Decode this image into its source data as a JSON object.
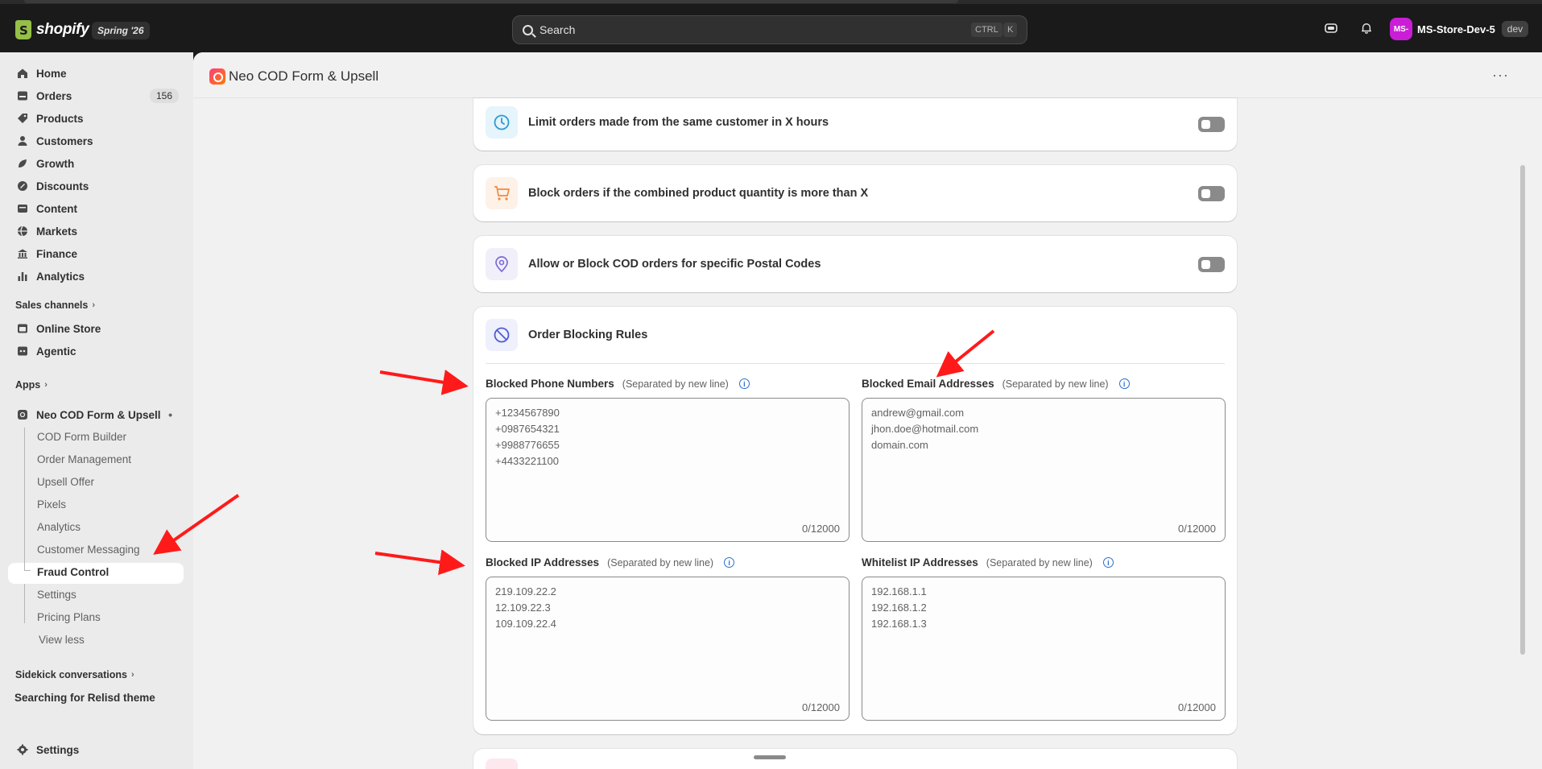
{
  "topbar": {
    "logo_text": "shopify",
    "version_badge": "Spring '26",
    "search_placeholder": "Search",
    "search_kbd_ctrl": "CTRL",
    "search_kbd_key": "K",
    "store_initials": "MS-",
    "store_name": "MS-Store-Dev-5",
    "store_badge": "dev"
  },
  "sidebar": {
    "items": [
      {
        "label": "Home",
        "icon": "home-icon"
      },
      {
        "label": "Orders",
        "icon": "orders-icon",
        "count": "156"
      },
      {
        "label": "Products",
        "icon": "tag-icon"
      },
      {
        "label": "Customers",
        "icon": "person-icon"
      },
      {
        "label": "Growth",
        "icon": "growth-icon"
      },
      {
        "label": "Discounts",
        "icon": "discount-icon"
      },
      {
        "label": "Content",
        "icon": "content-icon"
      },
      {
        "label": "Markets",
        "icon": "globe-icon"
      },
      {
        "label": "Finance",
        "icon": "bank-icon"
      },
      {
        "label": "Analytics",
        "icon": "chart-icon"
      }
    ],
    "sales_channels_label": "Sales channels",
    "channels": [
      {
        "label": "Online Store",
        "icon": "store-icon"
      },
      {
        "label": "Agentic",
        "icon": "agentic-icon"
      }
    ],
    "apps_label": "Apps",
    "app_name": "Neo COD Form & Upsell",
    "app_subitems": [
      "COD Form Builder",
      "Order Management",
      "Upsell Offer",
      "Pixels",
      "Analytics",
      "Customer Messaging",
      "Fraud Control",
      "Settings",
      "Pricing Plans",
      "View less"
    ],
    "active_subitem": "Fraud Control",
    "sidekick_label": "Sidekick conversations",
    "sidekick_item": "Searching for Relisd theme",
    "settings_label": "Settings"
  },
  "app_header": {
    "title": "Neo COD Form & Upsell",
    "more": "···"
  },
  "cards": [
    {
      "title": "Limit orders made from the same customer in X hours",
      "icon": "clock-icon",
      "enabled": false
    },
    {
      "title": "Block orders if the combined product quantity is more than X",
      "icon": "cart-icon",
      "enabled": false
    },
    {
      "title": "Allow or Block COD orders for specific Postal Codes",
      "icon": "location-pin-icon",
      "enabled": false
    }
  ],
  "blocking": {
    "title": "Order Blocking Rules",
    "hint": "(Separated by new line)",
    "info": "i",
    "fields": [
      {
        "label": "Blocked Phone Numbers",
        "lines": [
          "+1234567890",
          "+0987654321",
          "+9988776655",
          "+4433221100"
        ],
        "count": "0/12000"
      },
      {
        "label": "Blocked Email Addresses",
        "lines": [
          "andrew@gmail.com",
          "jhon.doe@hotmail.com",
          "domain.com"
        ],
        "count": "0/12000"
      },
      {
        "label": "Blocked IP Addresses",
        "lines": [
          "219.109.22.2",
          "12.109.22.3",
          "109.109.22.4"
        ],
        "count": "0/12000"
      },
      {
        "label": "Whitelist IP Addresses",
        "lines": [
          "192.168.1.1",
          "192.168.1.2",
          "192.168.1.3"
        ],
        "count": "0/12000"
      }
    ]
  },
  "colors": {
    "accent_blue": "#2c6ecb",
    "annotation_red": "#ff1a1a",
    "toggle_off": "#8a8a8a"
  }
}
